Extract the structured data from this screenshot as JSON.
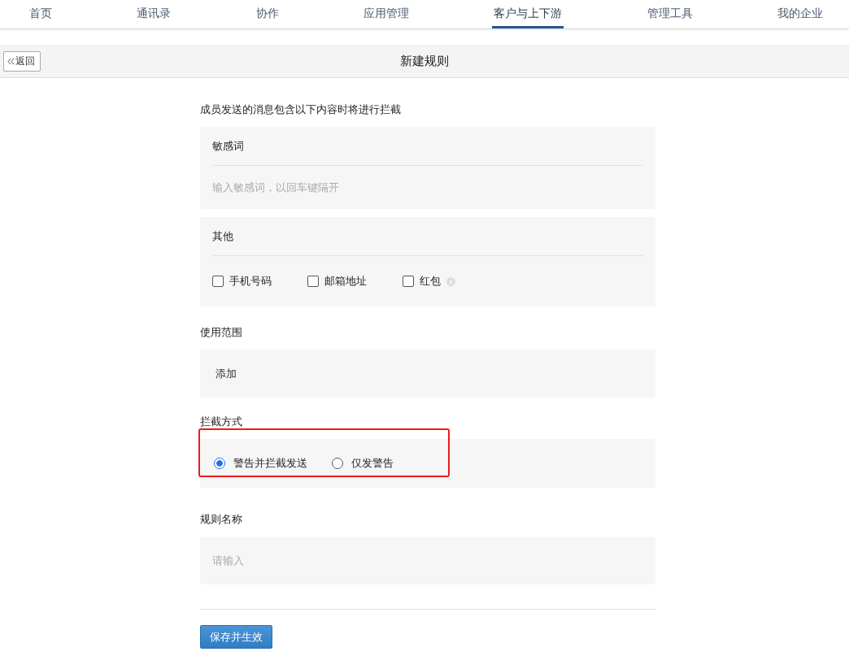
{
  "nav": {
    "items": [
      {
        "label": "首页",
        "selected": false
      },
      {
        "label": "通讯录",
        "selected": false
      },
      {
        "label": "协作",
        "selected": false
      },
      {
        "label": "应用管理",
        "selected": false
      },
      {
        "label": "客户与上下游",
        "selected": true
      },
      {
        "label": "管理工具",
        "selected": false
      },
      {
        "label": "我的企业",
        "selected": false
      }
    ]
  },
  "header": {
    "back": "返回",
    "title": "新建规则"
  },
  "form": {
    "intro": "成员发送的消息包含以下内容时将进行拦截",
    "sensitive": {
      "label": "敏感词",
      "placeholder": "输入敏感词，以回车键隔开"
    },
    "other": {
      "label": "其他",
      "options": [
        {
          "label": "手机号码",
          "checked": false,
          "info": false
        },
        {
          "label": "邮箱地址",
          "checked": false,
          "info": false
        },
        {
          "label": "红包",
          "checked": false,
          "info": true
        }
      ]
    },
    "scope": {
      "label": "使用范围",
      "add": "添加"
    },
    "intercept": {
      "label": "拦截方式",
      "highlighted": true,
      "options": [
        {
          "label": "警告并拦截发送",
          "selected": true
        },
        {
          "label": "仅发警告",
          "selected": false
        }
      ]
    },
    "name": {
      "label": "规则名称",
      "placeholder": "请输入"
    },
    "submit": "保存并生效"
  }
}
